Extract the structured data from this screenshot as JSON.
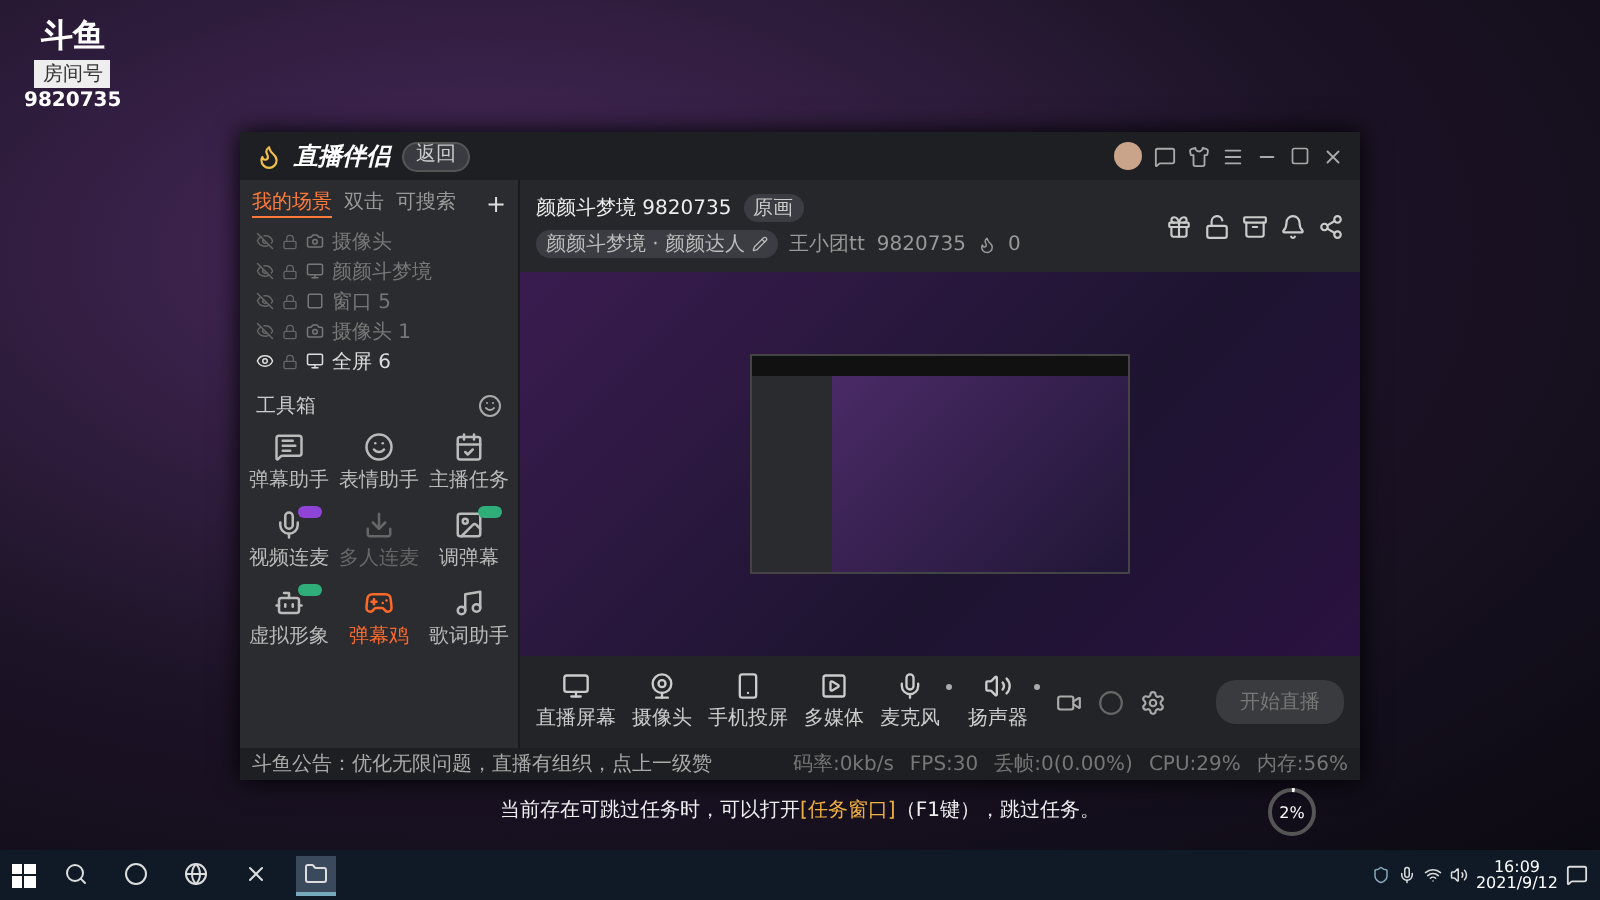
{
  "desktop_logo": {
    "brand": "斗鱼",
    "label": "房间号",
    "room": "9820735"
  },
  "window": {
    "app_name": "直播伴侣",
    "back_button": "返回",
    "scene_tabs": [
      {
        "label": "我的场景",
        "selected": true
      },
      {
        "label": "双击",
        "selected": false
      },
      {
        "label": "可搜索",
        "selected": false
      }
    ],
    "add_tab": "+",
    "sources": [
      {
        "label": "摄像头",
        "visible": false
      },
      {
        "label": "颜颜斗梦境",
        "visible": false
      },
      {
        "label": "窗口 5",
        "visible": false
      },
      {
        "label": "摄像头 1",
        "visible": false
      },
      {
        "label": "全屏 6",
        "visible": true
      }
    ],
    "toolbox": {
      "title": "工具箱",
      "tools": [
        {
          "label": "弹幕助手",
          "selected": false,
          "disabled": false
        },
        {
          "label": "表情助手",
          "selected": false,
          "disabled": false
        },
        {
          "label": "主播任务",
          "selected": false,
          "disabled": false
        },
        {
          "label": "视频连麦",
          "selected": false,
          "disabled": false,
          "color": "#8e44d6"
        },
        {
          "label": "多人连麦",
          "selected": false,
          "disabled": true
        },
        {
          "label": "调弹幕",
          "selected": false,
          "disabled": false,
          "color": "#2fae7a"
        },
        {
          "label": "虚拟形象",
          "selected": false,
          "disabled": false,
          "color": "#2fae7a"
        },
        {
          "label": "弹幕鸡",
          "selected": true,
          "disabled": false
        },
        {
          "label": "歌词助手",
          "selected": false,
          "disabled": false
        }
      ]
    },
    "room": {
      "title": "颜颜斗梦境 9820735",
      "quality": "原画",
      "tag": "颜颜斗梦境 · 颜颜达人",
      "owner": "王小团tt",
      "owner_id": "9820735",
      "heat": "0"
    },
    "controls": [
      {
        "label": "直播屏幕",
        "dropdown": false
      },
      {
        "label": "摄像头",
        "dropdown": false
      },
      {
        "label": "手机投屏",
        "dropdown": false
      },
      {
        "label": "多媒体",
        "dropdown": false
      },
      {
        "label": "麦克风",
        "dropdown": true
      },
      {
        "label": "扬声器",
        "dropdown": true
      }
    ],
    "start_button": {
      "label": "开始直播",
      "disabled": true
    },
    "notice": "斗鱼公告：优化无限问题，直播有组织，点上一级赞",
    "stats": [
      "码率:0kb/s",
      "FPS:30",
      "丢帧:0(0.00%)",
      "CPU:29%",
      "内存:56%"
    ]
  },
  "subtitle": {
    "before": "当前存在可跳过任务时，可以打开",
    "highlight": "[任务窗口]",
    "after": "（F1键），跳过任务。"
  },
  "progress": {
    "label": "2%",
    "level": 0.02
  },
  "taskbar": {
    "apps": [
      {
        "active": false
      },
      {
        "active": false
      },
      {
        "active": false
      },
      {
        "active": false
      },
      {
        "active": true
      }
    ],
    "time": "16:09",
    "date": "2021/9/12"
  }
}
